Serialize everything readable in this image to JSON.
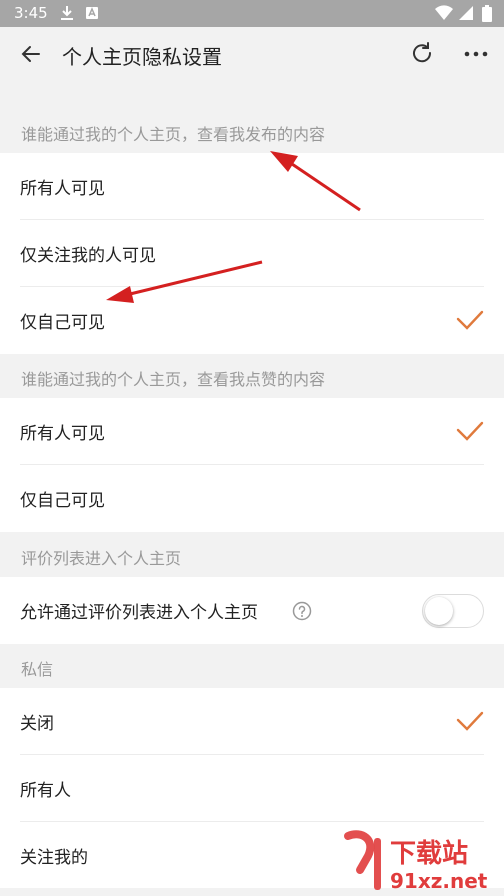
{
  "status_bar": {
    "time": "3:45"
  },
  "app_bar": {
    "title": "个人主页隐私设置"
  },
  "sections": [
    {
      "header": "谁能通过我的个人主页，查看我发布的内容",
      "options": [
        {
          "label": "所有人可见",
          "selected": false
        },
        {
          "label": "仅关注我的人可见",
          "selected": false
        },
        {
          "label": "仅自己可见",
          "selected": true
        }
      ]
    },
    {
      "header": "谁能通过我的个人主页，查看我点赞的内容",
      "options": [
        {
          "label": "所有人可见",
          "selected": true
        },
        {
          "label": "仅自己可见",
          "selected": false
        }
      ]
    },
    {
      "header": "评价列表进入个人主页",
      "toggle": {
        "label": "允许通过评价列表进入个人主页",
        "enabled": false
      }
    },
    {
      "header": "私信",
      "options": [
        {
          "label": "关闭",
          "selected": true
        },
        {
          "label": "所有人",
          "selected": false
        },
        {
          "label": "关注我的",
          "selected": false
        }
      ]
    }
  ],
  "colors": {
    "accent": "#e07a3c",
    "annotation_arrow": "#d42020"
  },
  "watermark": {
    "brand": "下载站",
    "url": "91xz.net"
  }
}
